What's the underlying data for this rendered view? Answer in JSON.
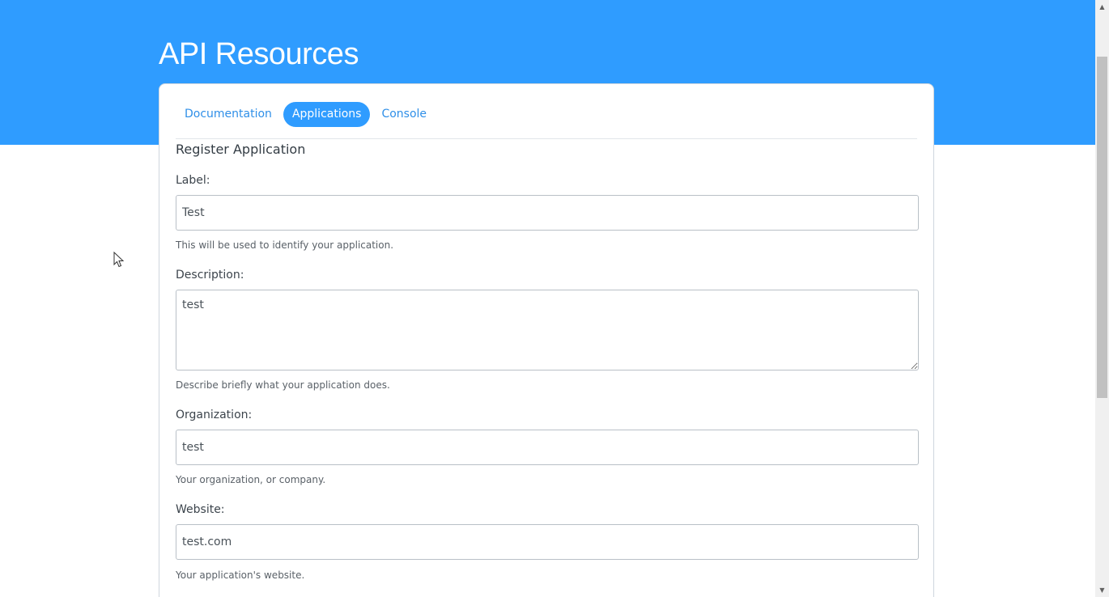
{
  "header": {
    "title": "API Resources",
    "background_color": "#2f9cff"
  },
  "tabs": [
    {
      "label": "Documentation",
      "active": false
    },
    {
      "label": "Applications",
      "active": true
    },
    {
      "label": "Console",
      "active": false
    }
  ],
  "form": {
    "section_title": "Register Application",
    "label": {
      "label": "Label:",
      "value": "Test",
      "help": "This will be used to identify your application."
    },
    "description": {
      "label": "Description:",
      "value": "test",
      "help": "Describe briefly what your application does."
    },
    "organization": {
      "label": "Organization:",
      "value": "test",
      "help": "Your organization, or company."
    },
    "website": {
      "label": "Website:",
      "value": "test.com",
      "help": "Your application's website."
    }
  },
  "icons": {
    "scroll_up": "scroll-up-arrow-icon",
    "scroll_down": "scroll-down-arrow-icon",
    "cursor": "mouse-pointer-icon"
  }
}
